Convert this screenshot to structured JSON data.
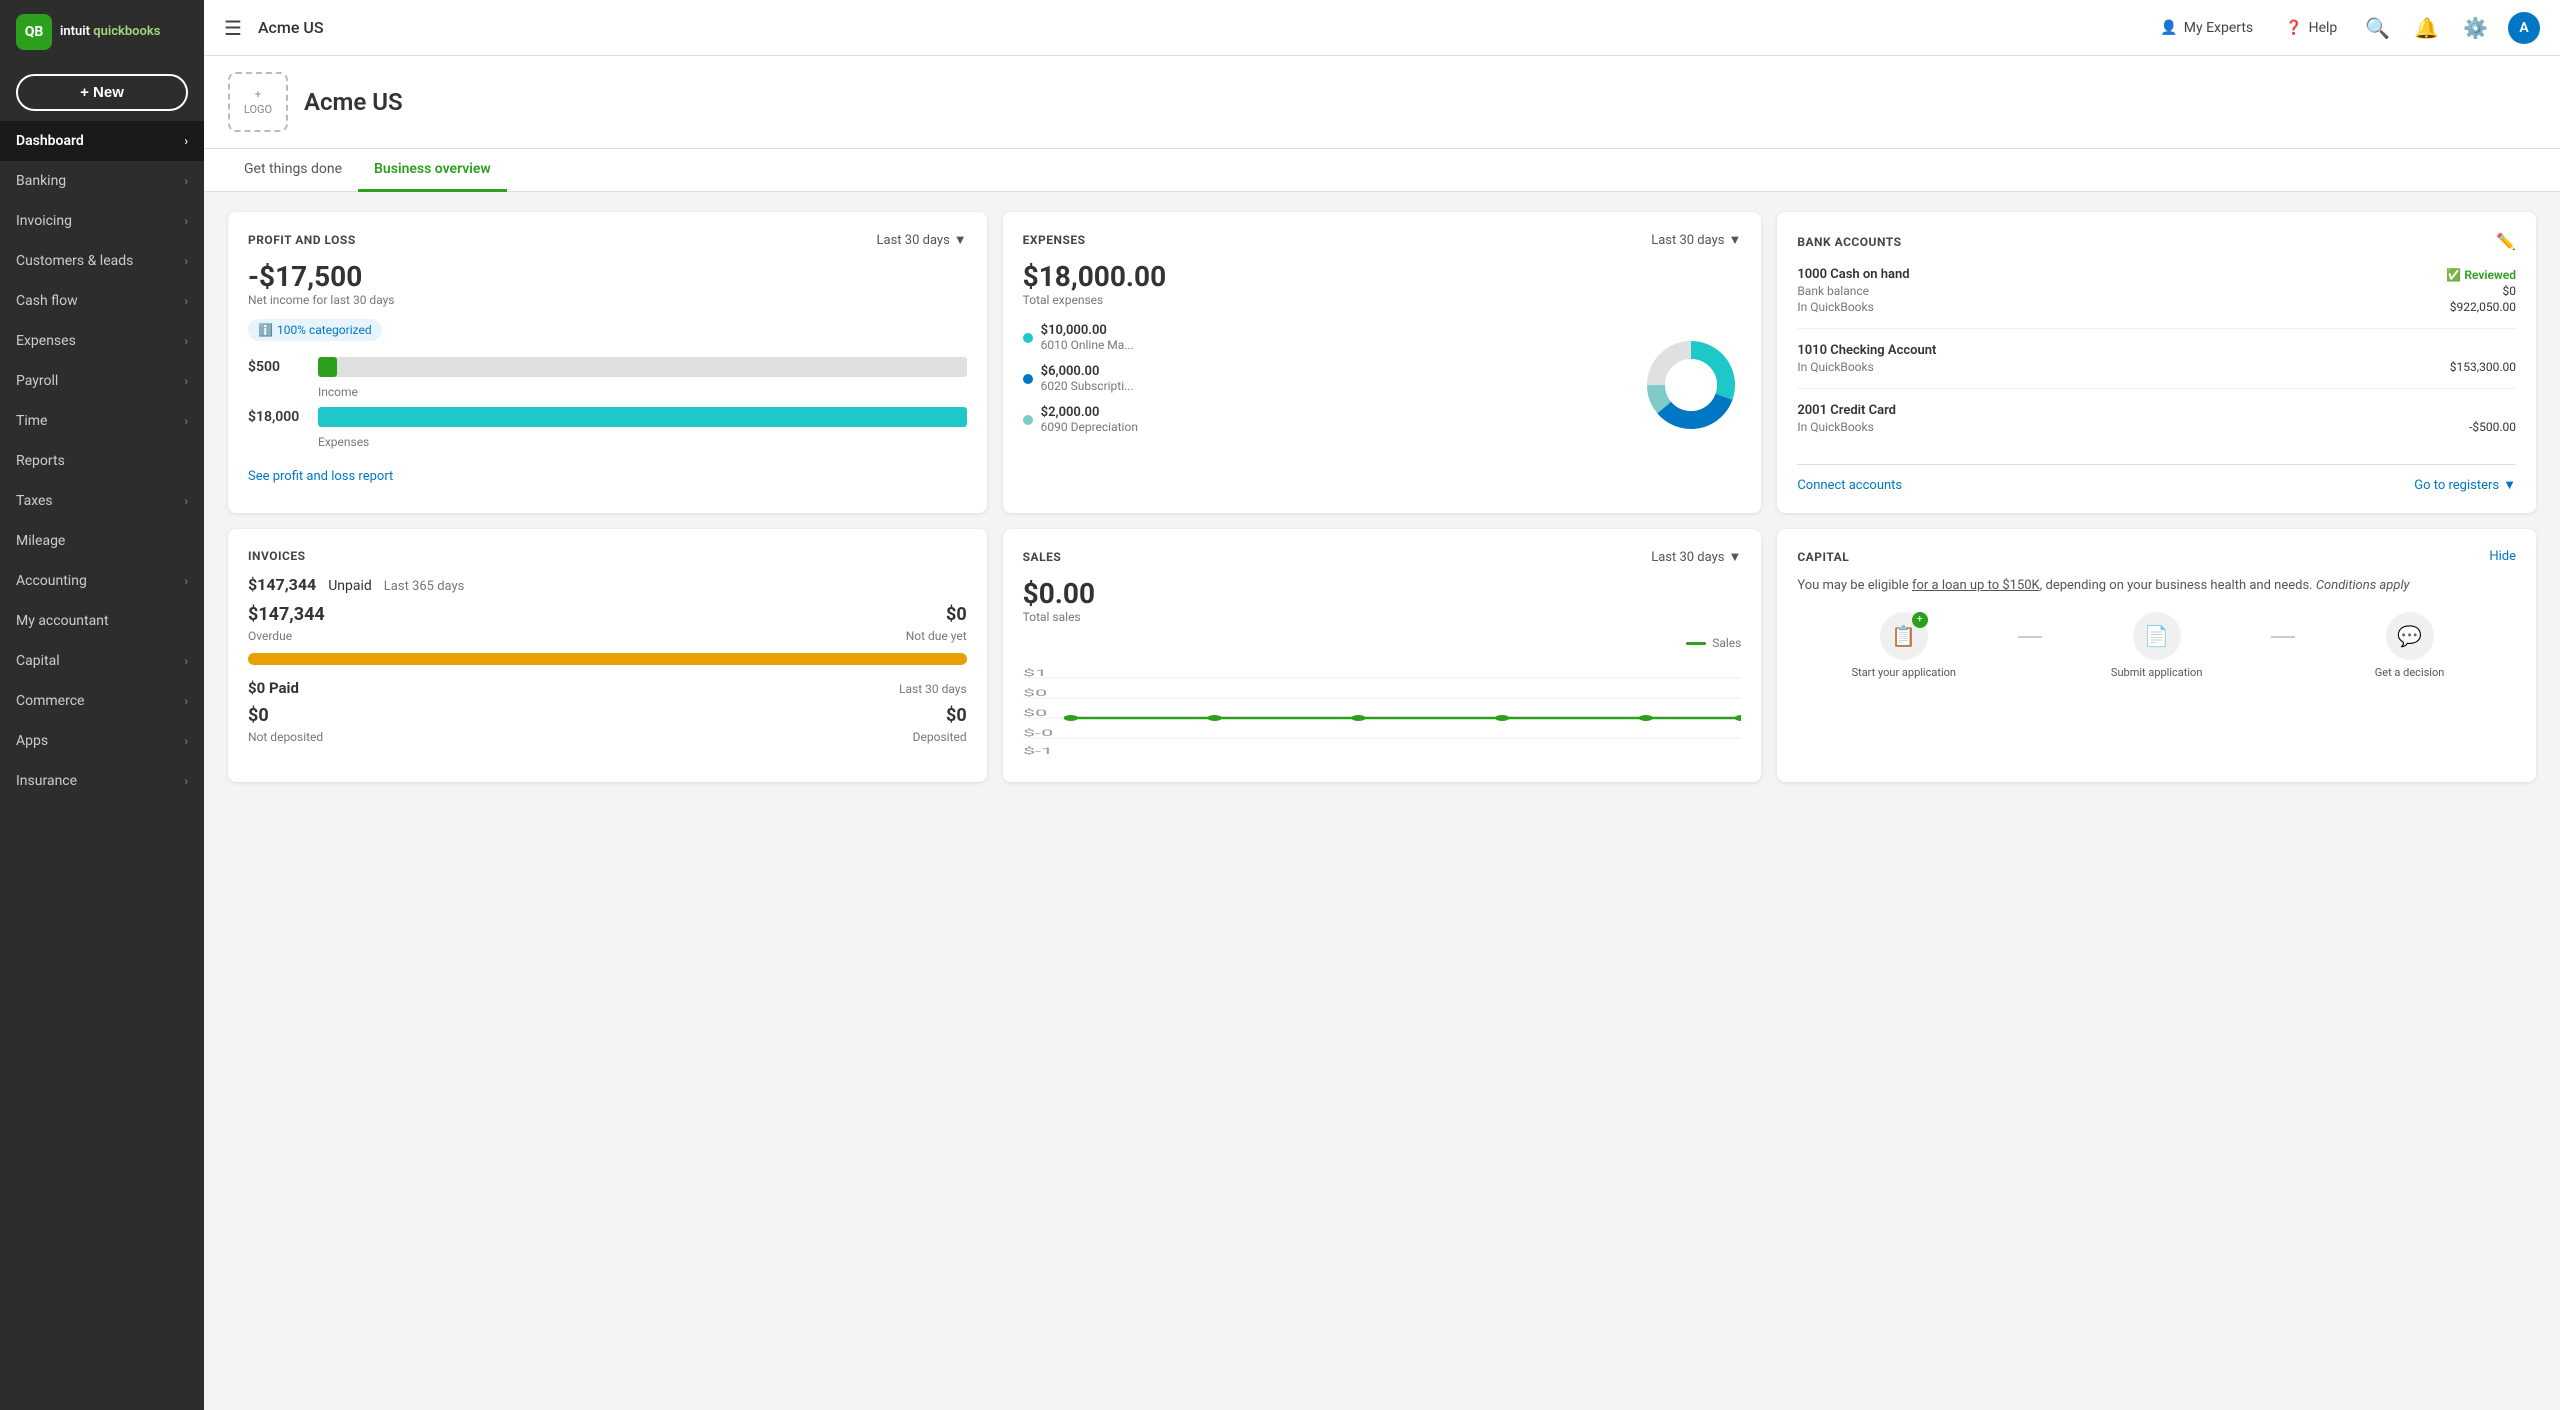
{
  "sidebar": {
    "logo": {
      "line1": "intuit",
      "line2": "quickbooks"
    },
    "new_button": "+ New",
    "items": [
      {
        "label": "Dashboard",
        "active": true,
        "has_chevron": true
      },
      {
        "label": "Banking",
        "active": false,
        "has_chevron": true
      },
      {
        "label": "Invoicing",
        "active": false,
        "has_chevron": true
      },
      {
        "label": "Customers & leads",
        "active": false,
        "has_chevron": true
      },
      {
        "label": "Cash flow",
        "active": false,
        "has_chevron": true
      },
      {
        "label": "Expenses",
        "active": false,
        "has_chevron": true
      },
      {
        "label": "Payroll",
        "active": false,
        "has_chevron": true
      },
      {
        "label": "Time",
        "active": false,
        "has_chevron": true
      },
      {
        "label": "Reports",
        "active": false,
        "has_chevron": false
      },
      {
        "label": "Taxes",
        "active": false,
        "has_chevron": true
      },
      {
        "label": "Mileage",
        "active": false,
        "has_chevron": false
      },
      {
        "label": "Accounting",
        "active": false,
        "has_chevron": true
      },
      {
        "label": "My accountant",
        "active": false,
        "has_chevron": false
      },
      {
        "label": "Capital",
        "active": false,
        "has_chevron": true
      },
      {
        "label": "Commerce",
        "active": false,
        "has_chevron": true
      },
      {
        "label": "Apps",
        "active": false,
        "has_chevron": true
      },
      {
        "label": "Insurance",
        "active": false,
        "has_chevron": true
      }
    ]
  },
  "header": {
    "company": "Acme US",
    "my_experts": "My Experts",
    "help": "Help",
    "avatar_letter": "A"
  },
  "biz": {
    "name": "Acme US",
    "logo_plus": "+",
    "logo_text": "LOGO"
  },
  "tabs": [
    {
      "label": "Get things done",
      "active": false
    },
    {
      "label": "Business overview",
      "active": true
    }
  ],
  "pnl": {
    "title": "PROFIT AND LOSS",
    "period": "Last 30 days",
    "net_income": "-$17,500",
    "net_income_label": "Net income for last 30 days",
    "categorized": "100% categorized",
    "income_val": "$500",
    "income_label": "Income",
    "expenses_val": "$18,000",
    "expenses_label": "Expenses",
    "see_report": "See profit and loss report",
    "income_bar_pct": 3,
    "expenses_bar_pct": 100
  },
  "expenses_card": {
    "title": "EXPENSES",
    "period": "Last 30 days",
    "total": "$18,000.00",
    "total_label": "Total expenses",
    "items": [
      {
        "label": "6010 Online Ma...",
        "amount": "$10,000.00",
        "color": "#1ec8c8"
      },
      {
        "label": "6020 Subscripti...",
        "amount": "$6,000.00",
        "color": "#0077c5"
      },
      {
        "label": "6090 Depreciation",
        "amount": "$2,000.00",
        "color": "#7ecac9"
      }
    ]
  },
  "bank_accounts": {
    "title": "BANK ACCOUNTS",
    "accounts": [
      {
        "name": "1000 Cash on hand",
        "reviewed": true,
        "reviewed_label": "Reviewed",
        "lines": [
          {
            "label": "Bank balance",
            "value": "$0"
          },
          {
            "label": "In QuickBooks",
            "value": "$922,050.00"
          }
        ]
      },
      {
        "name": "1010 Checking Account",
        "reviewed": false,
        "lines": [
          {
            "label": "In QuickBooks",
            "value": "$153,300.00"
          }
        ]
      },
      {
        "name": "2001 Credit Card",
        "reviewed": false,
        "lines": [
          {
            "label": "In QuickBooks",
            "value": "-$500.00"
          }
        ]
      }
    ],
    "connect": "Connect accounts",
    "registers": "Go to registers"
  },
  "invoices": {
    "title": "INVOICES",
    "unpaid_label": "Unpaid",
    "unpaid_period": "Last 365 days",
    "overdue_val": "$147,344",
    "not_due_val": "$0",
    "overdue_label": "Overdue",
    "not_due_label": "Not due yet",
    "paid_label": "$0 Paid",
    "paid_period": "Last 30 days",
    "not_deposited_val": "$0",
    "deposited_val": "$0",
    "not_deposited_label": "Not deposited",
    "deposited_label": "Deposited"
  },
  "sales": {
    "title": "SALES",
    "period": "Last 30 days",
    "total": "$0.00",
    "total_label": "Total sales",
    "legend": "Sales",
    "chart_labels": [
      "$1",
      "$0",
      "$0",
      "$-0",
      "$-1"
    ],
    "data_points": [
      0,
      0,
      0,
      0,
      0
    ]
  },
  "capital": {
    "title": "CAPITAL",
    "hide_label": "Hide",
    "text_part1": "You may be eligible ",
    "text_link": "for a loan up to $150K",
    "text_part2": ", depending on your business health and needs. ",
    "text_italic": "Conditions apply",
    "steps": [
      {
        "label": "Start your application",
        "icon": "📋",
        "has_badge": true
      },
      {
        "label": "Submit application",
        "icon": "📄",
        "has_badge": false
      },
      {
        "label": "Get a decision",
        "icon": "💬",
        "has_badge": false
      }
    ]
  }
}
